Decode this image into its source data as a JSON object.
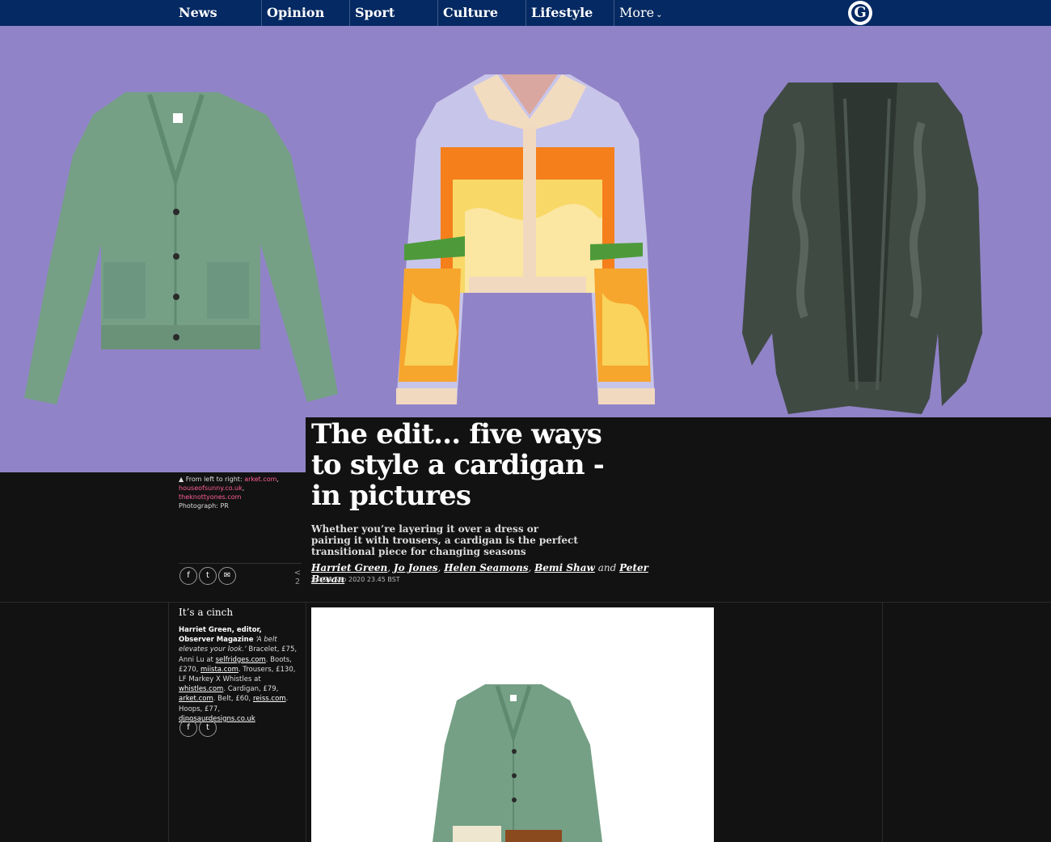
{
  "nav": {
    "items": [
      "News",
      "Opinion",
      "Sport",
      "Culture",
      "Lifestyle"
    ],
    "more_label": "More",
    "logo_letter": "G"
  },
  "colors": {
    "nav_bg": "#052962",
    "hero_bg": "#9183c7",
    "page_bg": "#121212",
    "link_pink": "#ff5e9a"
  },
  "hero": {
    "caption_prefix": "From left to right: ",
    "caption_links": [
      "arket.com",
      "houseofsunny.co.uk",
      "theknottyones.com"
    ],
    "caption_credit": "Photograph: PR"
  },
  "article": {
    "headline": "The edit… five ways to style a cardigan - in pictures",
    "standfirst": "Whether you’re layering it over a dress or pairing it with trousers, a cardigan is the perfect transitional piece for changing seasons",
    "authors": [
      "Harriet Green",
      "Jo Jones",
      "Helen Seamons",
      "Bemi Shaw",
      "Peter Bevan"
    ],
    "byline_and": "and",
    "dateline": "Sat 26 Sep 2020 23.45 BST",
    "share_count_top": "<",
    "share_count": "2"
  },
  "share": {
    "facebook": "f",
    "twitter": "t",
    "email": "✉"
  },
  "gallery_item": {
    "title": "It’s a cinch",
    "caption_bold": "Harriet Green, editor, Observer Magazine",
    "caption_quote": "‘A belt elevates your look.’",
    "caption_parts": [
      {
        "text": " Bracelet, £75, Anni Lu at ",
        "link": false
      },
      {
        "text": "selfridges.com",
        "link": true
      },
      {
        "text": ". Boots, £270, ",
        "link": false
      },
      {
        "text": "miista.com",
        "link": true
      },
      {
        "text": ". Trousers, £130, LF Markey X Whistles at ",
        "link": false
      },
      {
        "text": "whistles.com",
        "link": true
      },
      {
        "text": ". Cardigan, £79, ",
        "link": false
      },
      {
        "text": "arket.com",
        "link": true
      },
      {
        "text": ". Belt, £60, ",
        "link": false
      },
      {
        "text": "reiss.com",
        "link": true
      },
      {
        "text": ". Hoops, £77, ",
        "link": false
      },
      {
        "text": "dinosaurdesigns.co.uk",
        "link": true
      }
    ]
  }
}
